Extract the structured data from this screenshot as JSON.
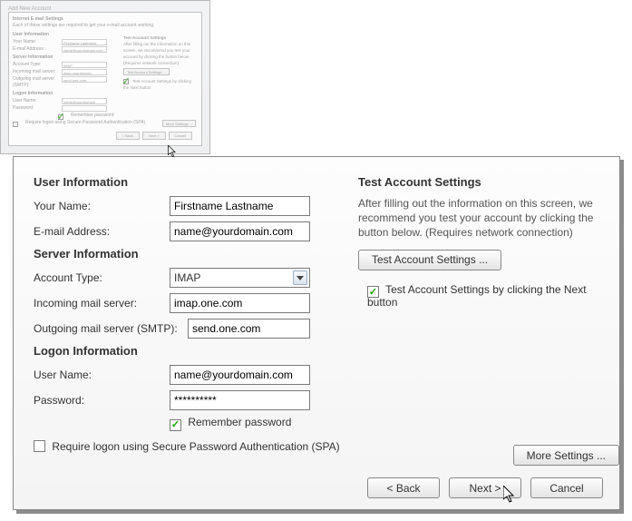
{
  "thumb": {
    "window_title": "Add New Account",
    "subtitle_1": "Internet E-mail Settings",
    "subtitle_2": "Each of these settings are required to get your e-mail account working.",
    "user_information": "User Information",
    "your_name_label": "Your Name:",
    "your_name_value": "Firstname Lastname",
    "email_label": "E-mail Address:",
    "email_value": "name@yourdomain.com",
    "server_information": "Server Information",
    "account_type_label": "Account Type:",
    "account_type_value": "IMAP",
    "incoming_label": "Incoming mail server:",
    "incoming_value": "imap.yourdomain",
    "outgoing_label": "Outgoing mail server (SMTP):",
    "outgoing_value": "send.one.com",
    "logon_information": "Logon Information",
    "user_name_label": "User Name:",
    "user_name_value": "name@yourdomain",
    "password_label": "Password:",
    "remember_password": "Remember password",
    "spa_label": "Require logon using Secure Password Authentication (SPA)",
    "test_heading": "Test Account Settings",
    "test_desc": "After filling out the information on this screen, we recommend you test your account by clicking the button below. (Requires network connection)",
    "test_button": "Test Account Settings ...",
    "test_checkbox": "Test Account Settings by clicking the Next button",
    "more_settings": "More Settings ...",
    "back": "< Back",
    "next": "Next >",
    "cancel": "Cancel"
  },
  "dialog": {
    "user_information_heading": "User Information",
    "your_name_label": "Your Name:",
    "your_name_value": "Firstname Lastname",
    "email_label": "E-mail Address:",
    "email_value": "name@yourdomain.com",
    "server_information_heading": "Server Information",
    "account_type_label": "Account Type:",
    "account_type_value": "IMAP",
    "incoming_label": "Incoming mail server:",
    "incoming_value": "imap.one.com",
    "outgoing_label": "Outgoing mail server (SMTP):",
    "outgoing_value": "send.one.com",
    "logon_information_heading": "Logon Information",
    "user_name_label": "User Name:",
    "user_name_value": "name@yourdomain.com",
    "password_label": "Password:",
    "password_value": "**********",
    "remember_password_label": "Remember password",
    "spa_label": "Require logon using Secure Password Authentication (SPA)",
    "test_heading": "Test Account Settings",
    "test_desc": "After filling out the information on this screen, we recommend you test your account by clicking the button below. (Requires network connection)",
    "test_button_label": "Test Account Settings ...",
    "test_checkbox_label": "Test Account Settings by clicking the Next button",
    "more_settings_label": "More Settings ...",
    "back_label": "< Back",
    "next_label": "Next >",
    "cancel_label": "Cancel"
  }
}
